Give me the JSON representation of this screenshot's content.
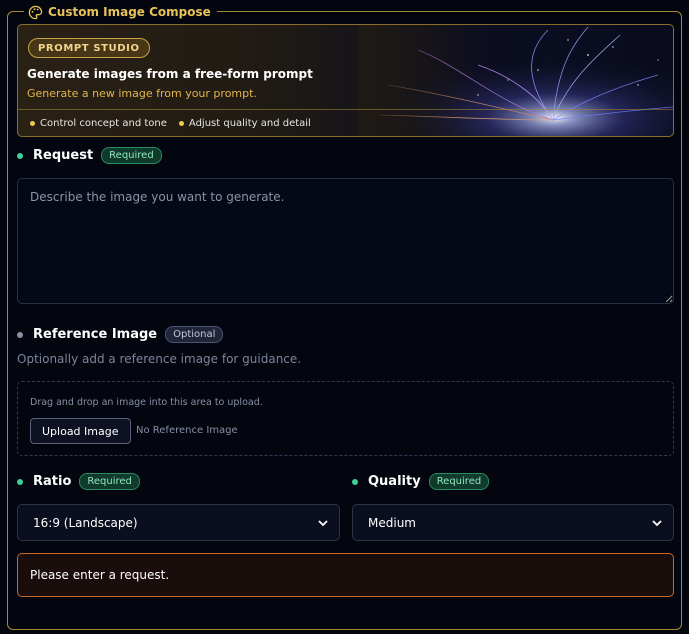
{
  "panel": {
    "title": "Custom Image Compose",
    "icon": "palette-icon",
    "accent": "#e9c257"
  },
  "banner": {
    "badge": "PROMPT STUDIO",
    "title": "Generate images from a free-form prompt",
    "subtitle": "Generate a new image from your prompt.",
    "features": [
      "Control concept and tone",
      "Adjust quality and detail"
    ]
  },
  "request": {
    "label": "Request",
    "badge": "Required",
    "placeholder": "Describe the image you want to generate.",
    "value": ""
  },
  "reference": {
    "label": "Reference Image",
    "badge": "Optional",
    "help": "Optionally add a reference image for guidance.",
    "dropzone_text": "Drag and drop an image into this area to upload.",
    "upload_label": "Upload Image",
    "status": "No Reference Image"
  },
  "ratio": {
    "label": "Ratio",
    "badge": "Required",
    "selected": "16:9 (Landscape)"
  },
  "quality": {
    "label": "Quality",
    "badge": "Required",
    "selected": "Medium"
  },
  "alert": {
    "message": "Please enter a request.",
    "color": "#c46a2a"
  }
}
